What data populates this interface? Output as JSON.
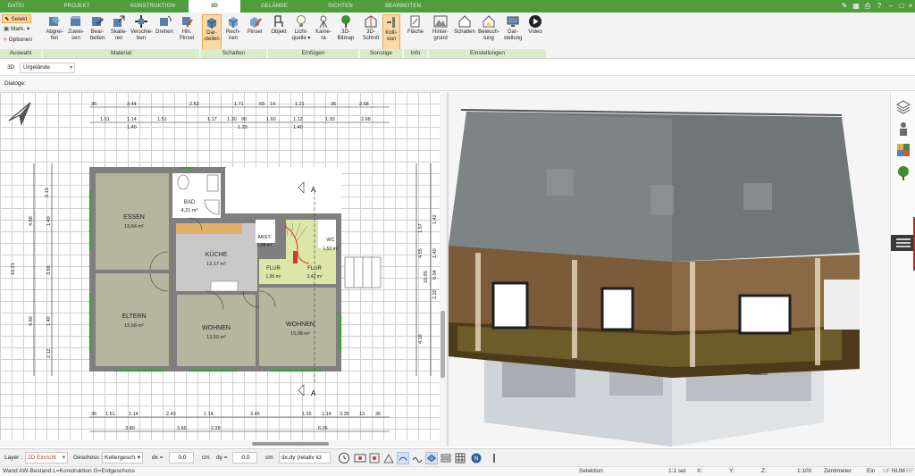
{
  "menu": {
    "tabs": [
      "DATEI",
      "PROJEKT",
      "KONSTRUKTION",
      "3D",
      "GELÄNDE",
      "SICHTEN",
      "BEARBEITEN"
    ],
    "active_tab": "3D"
  },
  "ribbon": {
    "selection": {
      "selekt": "Selekt",
      "mark": "Mark.",
      "optionen": "Optionen",
      "group": "Auswahl"
    },
    "material": {
      "buttons": [
        {
          "l1": "Abgrei-",
          "l2": "fen"
        },
        {
          "l1": "Zuwei-",
          "l2": "sen"
        },
        {
          "l1": "Bear-",
          "l2": "beiten"
        },
        {
          "l1": "Skalie-",
          "l2": "ren"
        },
        {
          "l1": "Verschie-",
          "l2": "ben"
        },
        {
          "l1": "Drehen",
          "l2": ""
        },
        {
          "l1": "Hin.",
          "l2": "Pinsel"
        }
      ],
      "group": "Material"
    },
    "schatten": {
      "buttons": [
        {
          "l1": "Dar-",
          "l2": "stellen"
        },
        {
          "l1": "Rech-",
          "l2": "nen"
        },
        {
          "l1": "Pinsel",
          "l2": ""
        }
      ],
      "group": "Schatten"
    },
    "einfuegen": {
      "buttons": [
        {
          "l1": "Objekt",
          "l2": ""
        },
        {
          "l1": "Licht-",
          "l2": "quelle ▾"
        },
        {
          "l1": "Kame-",
          "l2": "ra"
        },
        {
          "l1": "3D-",
          "l2": "Bitmap"
        }
      ],
      "group": "Einfügen"
    },
    "sonstige": {
      "buttons": [
        {
          "l1": "3D-",
          "l2": "Schnitt"
        },
        {
          "l1": "Kolli-",
          "l2": "sion"
        }
      ],
      "group": "Sonstige"
    },
    "info": {
      "buttons": [
        {
          "l1": "Fläche",
          "l2": ""
        }
      ],
      "group": "Info"
    },
    "einstellungen": {
      "buttons": [
        {
          "l1": "Hinter-",
          "l2": "grund"
        },
        {
          "l1": "Schatten",
          "l2": ""
        },
        {
          "l1": "Beleuch-",
          "l2": "tung"
        },
        {
          "l1": "Dar-",
          "l2": "stellung"
        },
        {
          "l1": "Video",
          "l2": ""
        }
      ],
      "group": "Einstellungen"
    }
  },
  "bar3d": {
    "label": "3D",
    "combo_value": "Urgelände"
  },
  "dialoge_label": "Dialoge:",
  "plan": {
    "rooms": [
      {
        "name": "ESSEN",
        "area": "15,84 m²"
      },
      {
        "name": "ELTERN",
        "area": "15,68 m²"
      },
      {
        "name": "KÜCHE",
        "area": "12,17 m²"
      },
      {
        "name": "WOHNEN",
        "area": "13,59 m²"
      },
      {
        "name": "WOHNEN",
        "area": "15,38 m²"
      },
      {
        "name": "BAD",
        "area": "4,21 m²"
      },
      {
        "name": "ABST.",
        "area": "1,08 m²"
      },
      {
        "name": "FLUR",
        "area": "1,96 m²"
      },
      {
        "name": "FLUR",
        "area": "3,43 m²"
      },
      {
        "name": "WC",
        "area": "1,52 m²"
      }
    ],
    "section_marker": "A",
    "dims_top_1": [
      "36",
      "3.44",
      "2.52",
      "1.71",
      "69",
      "14",
      "1.21",
      "36",
      "2.68"
    ],
    "dims_top_2": [
      "1.51",
      "1.14",
      "1.40",
      "1.51",
      "1.17",
      "1.30",
      "90",
      "1.20",
      "1.60",
      "1.12",
      "1.40",
      "1.93",
      "2.68"
    ],
    "dims_bottom_1": [
      "36",
      "1.51",
      "1.14",
      "2.43",
      "1.14",
      "3.45",
      "1.55",
      "1.14",
      "3.35",
      "13",
      "36"
    ],
    "dims_bottom_2": [
      "3.80",
      "3.69",
      "2.28",
      "6.06"
    ],
    "dims_left": [
      "2.13",
      "4.68",
      "1.40",
      "3.68",
      "4.60",
      "1.40",
      "2.12",
      "10.21"
    ],
    "dims_right": [
      "1.57",
      "4.55",
      "1.40",
      "6.04",
      "2.20",
      "4.18",
      "10.95",
      "1.42"
    ]
  },
  "bottom_toolbar": {
    "layer_label": "Layer :",
    "layer_value": "2D Einricht",
    "geschoss_label": "Geschoss :",
    "geschoss_value": "Kellergesch",
    "dx_label": "dx =",
    "dx_value": "0,0",
    "cm1": "cm",
    "dy_label": "dy =",
    "dy_value": "0,0",
    "cm2": "cm",
    "mode_value": "dx,dy (relativ kz"
  },
  "status": {
    "left": "Wand AW-Bestand L=Konstruktion G=Erdgeschoss",
    "mode": "Selektion",
    "sel": "1:1 sel",
    "x": "X:",
    "y": "Y:",
    "z": "Z:",
    "scale": "1:100",
    "unit": "Zentimeter",
    "ein": "Ein",
    "uf": "UF",
    "num": "NUM",
    "rf": "RF"
  },
  "colors": {
    "menu_green": "#4f9d3c",
    "group_green": "#d9ecc9",
    "selected_orange": "#fbd9a5",
    "room_fill": "#b6b59d",
    "wall": "#7f7f7f",
    "roof": "#6f7677"
  }
}
